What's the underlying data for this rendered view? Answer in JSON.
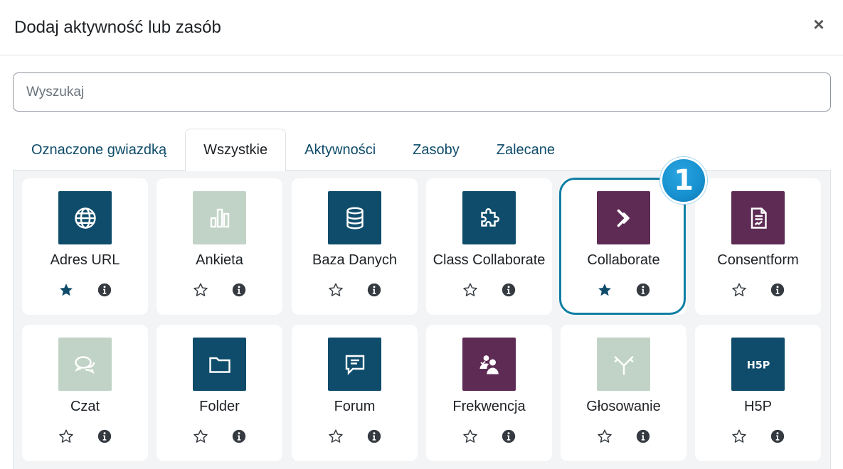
{
  "header": {
    "title": "Dodaj aktywność lub zasób",
    "close_label": "×"
  },
  "search": {
    "placeholder": "Wyszukaj"
  },
  "tabs": [
    {
      "label": "Oznaczone gwiazdką",
      "active": false
    },
    {
      "label": "Wszystkie",
      "active": true
    },
    {
      "label": "Aktywności",
      "active": false
    },
    {
      "label": "Zasoby",
      "active": false
    },
    {
      "label": "Zalecane",
      "active": false
    }
  ],
  "callout": {
    "number": "1"
  },
  "colors": {
    "teal": "#0f4c6b",
    "purple": "#5d2b53",
    "sage": "#c1d3c6",
    "highlight": "#0f7ea3",
    "badge": "#1790cf"
  },
  "items": [
    {
      "name": "Adres URL",
      "icon": "globe-icon",
      "color": "#0f4c6b",
      "starred": true
    },
    {
      "name": "Ankieta",
      "icon": "bar-chart-icon",
      "color": "#c1d3c6",
      "starred": false
    },
    {
      "name": "Baza Danych",
      "icon": "database-icon",
      "color": "#0f4c6b",
      "starred": false
    },
    {
      "name": "Class Collaborate",
      "icon": "puzzle-icon",
      "color": "#0f4c6b",
      "starred": false
    },
    {
      "name": "Collaborate",
      "icon": "chevrons-right-icon",
      "color": "#5d2b53",
      "starred": true
    },
    {
      "name": "Consentform",
      "icon": "signed-document-icon",
      "color": "#5d2b53",
      "starred": false
    },
    {
      "name": "Czat",
      "icon": "chat-bubbles-icon",
      "color": "#c1d3c6",
      "starred": false
    },
    {
      "name": "Folder",
      "icon": "folder-icon",
      "color": "#0f4c6b",
      "starred": false
    },
    {
      "name": "Forum",
      "icon": "forum-message-icon",
      "color": "#0f4c6b",
      "starred": false
    },
    {
      "name": "Frekwencja",
      "icon": "attendance-people-icon",
      "color": "#5d2b53",
      "starred": false
    },
    {
      "name": "Głosowanie",
      "icon": "signpost-arrows-icon",
      "color": "#c1d3c6",
      "starred": false
    },
    {
      "name": "H5P",
      "icon": "h5p-logo-icon",
      "color": "#0f4c6b",
      "starred": false
    }
  ]
}
